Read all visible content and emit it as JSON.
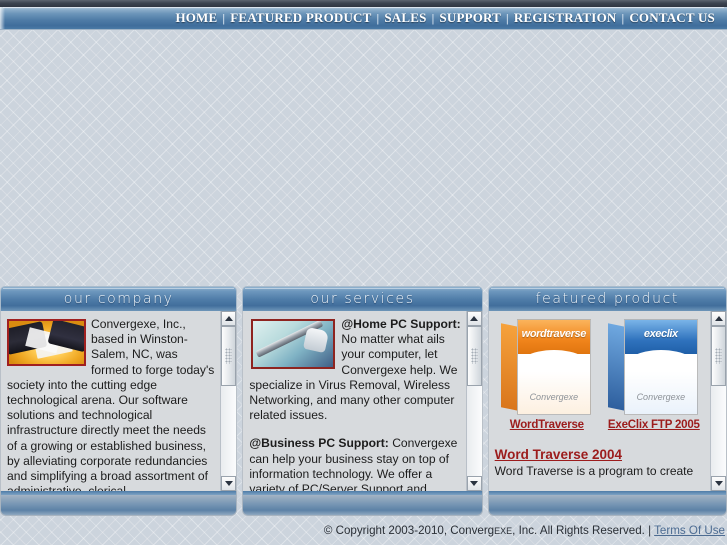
{
  "site": {
    "company": "Convergexe, Inc."
  },
  "nav": {
    "separator": "|",
    "items": [
      {
        "label": "HOME"
      },
      {
        "label": "FEATURED PRODUCT"
      },
      {
        "label": "SALES"
      },
      {
        "label": "SUPPORT"
      },
      {
        "label": "REGISTRATION"
      },
      {
        "label": "CONTACT US"
      }
    ]
  },
  "panels": {
    "company": {
      "title": "our company",
      "image_alt": "handshake-photo",
      "body": "Convergexe, Inc., based in Winston-Salem, NC, was formed to forge today's society into the cutting edge technological arena. Our software solutions and technological infrastructure directly meet the needs of a growing or established business, by alleviating corporate redundancies and simplifying a broad assortment of administrative, clerical,"
    },
    "services": {
      "title": "our services",
      "image_alt": "tools-photo",
      "home_heading": "@Home PC Support:",
      "home_body": "No matter what ails your computer, let Convergexe help.  We specialize in Virus Removal, Wireless Networking, and many other computer related issues.",
      "business_heading": "@Business PC Support:",
      "business_body": "Convergexe can help your business stay on top of information technology. We offer a variety of PC/Server Support and Service"
    },
    "featured": {
      "title": "featured product",
      "products": [
        {
          "box_title": "wordtraverse",
          "box_brand": "Convergexe",
          "link_label": "WordTraverse"
        },
        {
          "box_title": "execlix",
          "box_brand": "Convergexe",
          "link_label": "ExeClix FTP 2005"
        }
      ],
      "headline": "Word Traverse 2004",
      "blurb": "Word Traverse is a program to create"
    }
  },
  "scrollbars": {
    "up_arrow": "scroll-up",
    "down_arrow": "scroll-down"
  },
  "footer": {
    "copyright_prefix": "© Copyright 2003-2010, Converg",
    "copyright_smallcaps": "EXE",
    "copyright_suffix": ", Inc. All Rights Reserved. ",
    "divider": "| ",
    "terms_label": "Terms Of Use"
  }
}
